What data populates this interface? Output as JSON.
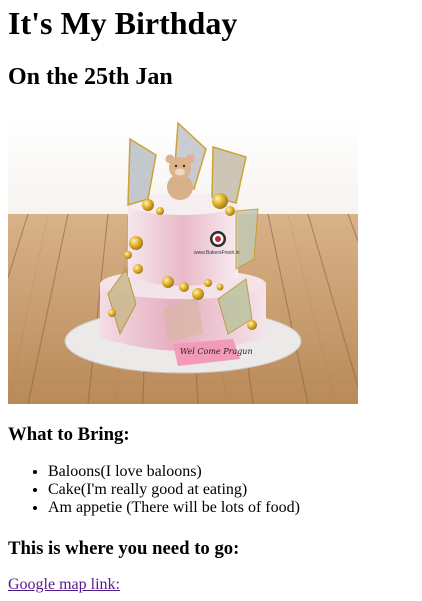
{
  "header": {
    "title": "It's My Birthday",
    "date": "On the 25th Jan"
  },
  "hero": {
    "cake_topper_text": "Wel Come Pragun",
    "watermark": "www.BakersFresh.in"
  },
  "bring": {
    "heading": "What to Bring:",
    "items": [
      "Baloons(I love baloons)",
      "Cake(I'm really good at eating)",
      "Am appetie (There will be lots of food)"
    ]
  },
  "directions": {
    "heading": "This is where you need to go:",
    "link_label": "Google map link:"
  },
  "colors": {
    "text": "#000000",
    "visited_link": "#551a8b",
    "floor_wood": "#c89d6f",
    "cake_pink": "#e9b7c6",
    "gold_accent": "#d4a72c"
  }
}
